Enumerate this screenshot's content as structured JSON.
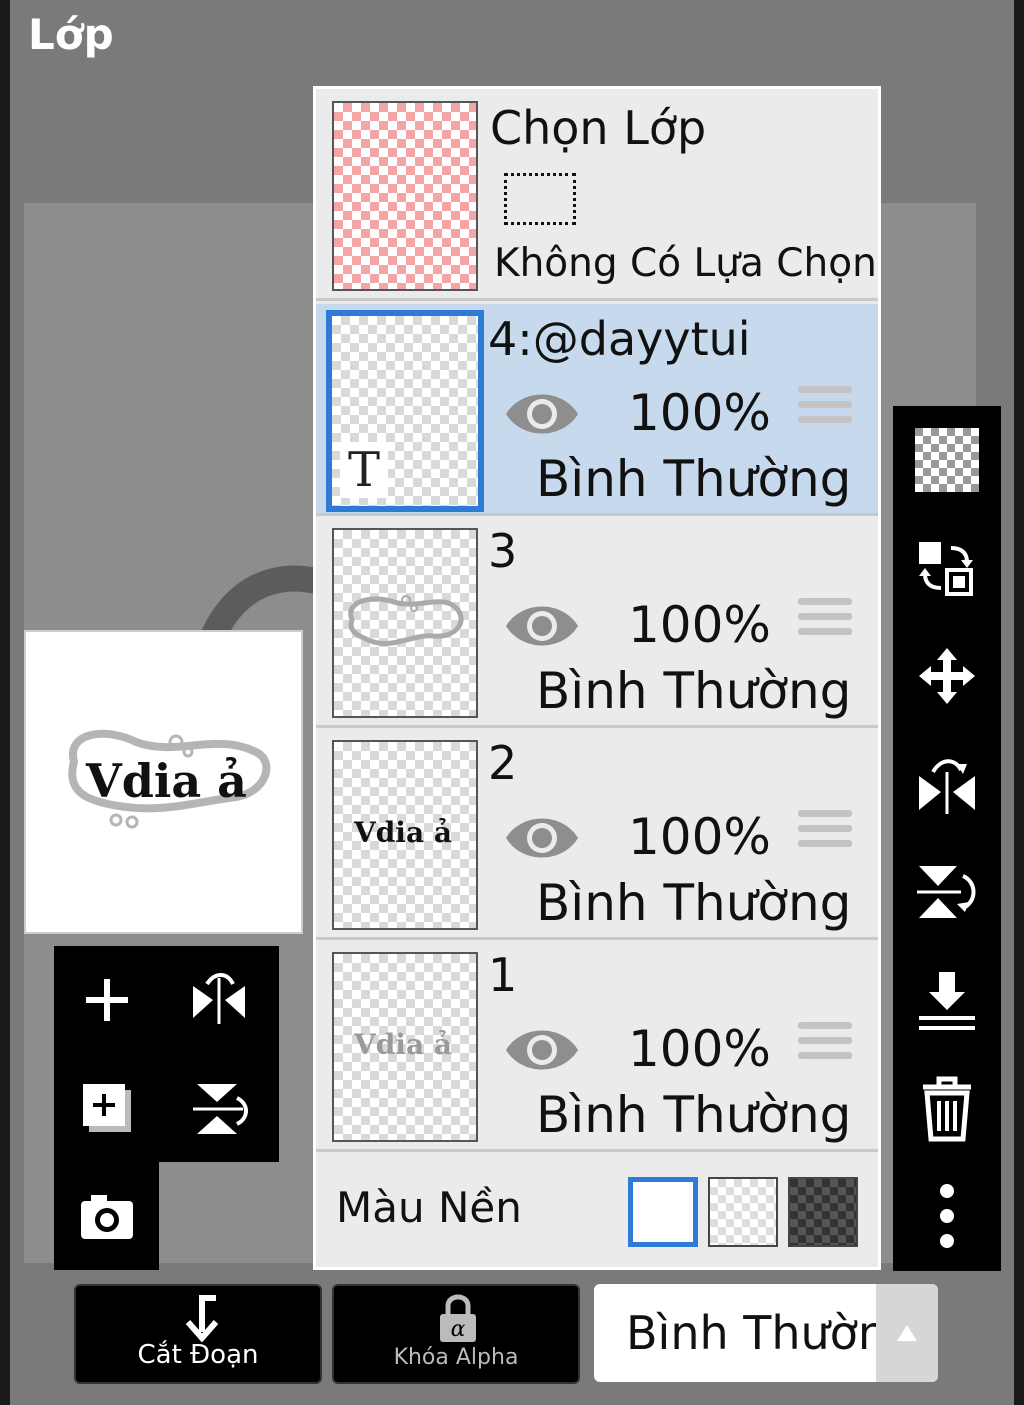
{
  "header": {
    "title": "Lớp"
  },
  "selection": {
    "title": "Chọn Lớp",
    "status": "Không Có Lựa Chọn"
  },
  "layers": [
    {
      "name": "4:@dayytui",
      "opacity": "100%",
      "blend": "Bình Thường",
      "selected": true,
      "thumb_text": "T"
    },
    {
      "name": "3",
      "opacity": "100%",
      "blend": "Bình Thường",
      "selected": false
    },
    {
      "name": "2",
      "opacity": "100%",
      "blend": "Bình Thường",
      "selected": false,
      "thumb_text": "Vdia ả"
    },
    {
      "name": "1",
      "opacity": "100%",
      "blend": "Bình Thường",
      "selected": false,
      "thumb_text": "Vdia ả"
    }
  ],
  "background": {
    "label": "Màu Nền",
    "options": [
      "white",
      "transparent",
      "dark-checker"
    ],
    "selected": "white"
  },
  "preview": {
    "art_text": "Vdia ả"
  },
  "bottom": {
    "clip_label": "Cắt Đoạn",
    "alpha_lock_label": "Khóa Alpha",
    "blend_mode": "Bình Thường"
  },
  "colors": {
    "accent": "#2f7ad6",
    "selected_row": "#c7d9ec",
    "panel": "#ebebeb",
    "toolbar": "#000000"
  }
}
